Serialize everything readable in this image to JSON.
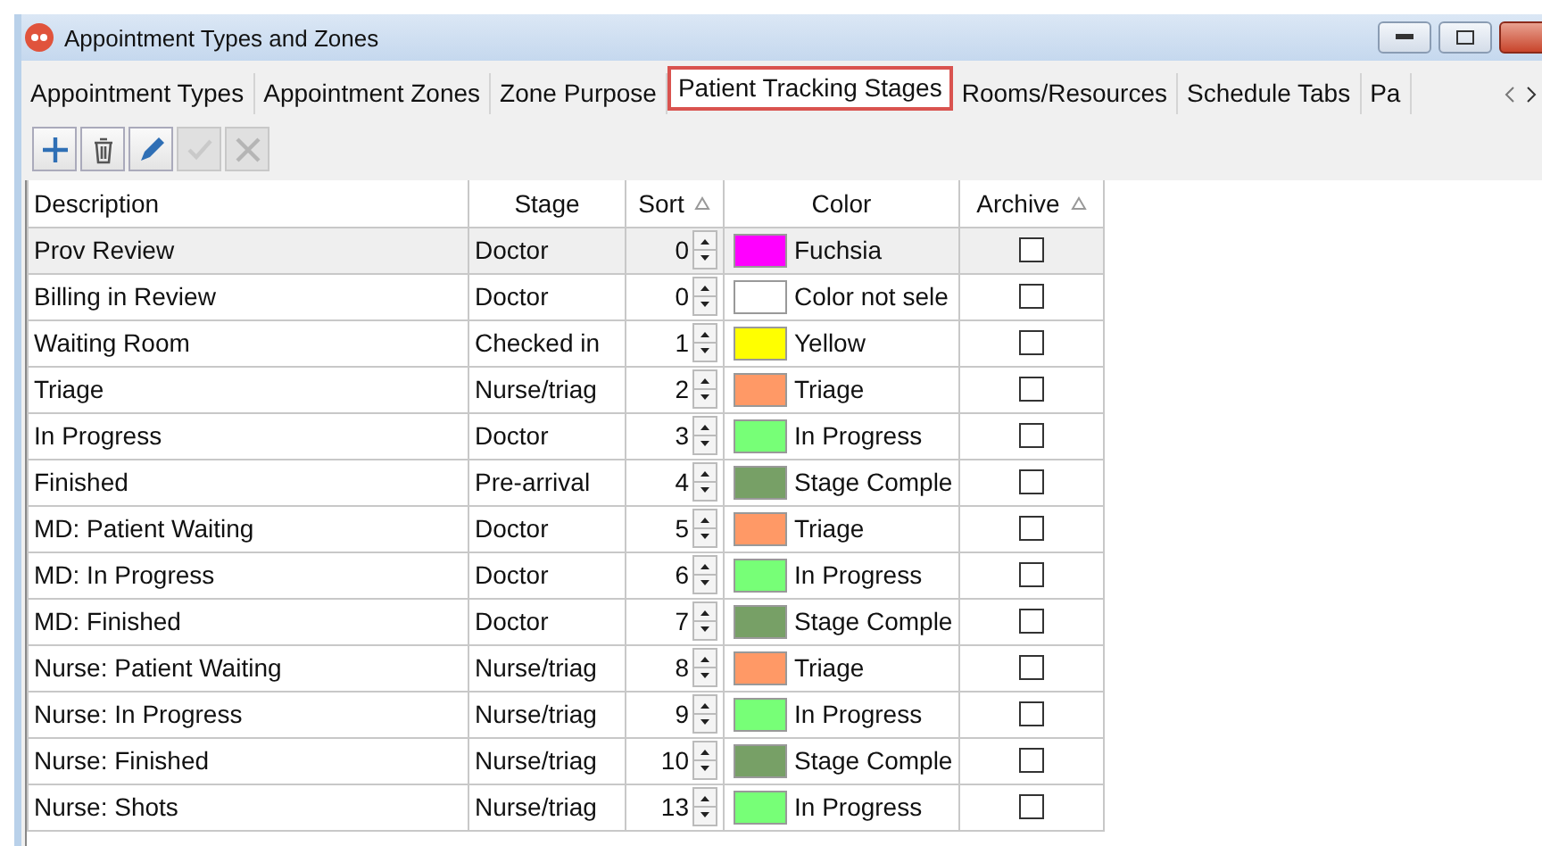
{
  "window": {
    "title": "Appointment Types and Zones"
  },
  "tabs": [
    {
      "label": "Appointment Types",
      "selected": false
    },
    {
      "label": "Appointment Zones",
      "selected": false
    },
    {
      "label": "Zone Purpose",
      "selected": false
    },
    {
      "label": "Patient Tracking Stages",
      "selected": true
    },
    {
      "label": "Rooms/Resources",
      "selected": false
    },
    {
      "label": "Schedule Tabs",
      "selected": false
    },
    {
      "label": "Pa",
      "selected": false
    }
  ],
  "toolbar": [
    {
      "kind": "add",
      "disabled": false
    },
    {
      "kind": "delete",
      "disabled": false
    },
    {
      "kind": "edit",
      "disabled": false
    },
    {
      "kind": "save",
      "disabled": true
    },
    {
      "kind": "cancel",
      "disabled": true
    }
  ],
  "table": {
    "columns": [
      {
        "label": "Description",
        "sorted": false
      },
      {
        "label": "Stage",
        "sorted": false
      },
      {
        "label": "Sort",
        "sorted": true
      },
      {
        "label": "Color",
        "sorted": false
      },
      {
        "label": "Archive",
        "sorted": true
      }
    ],
    "rows": [
      {
        "description": "Prov Review",
        "stage": "Doctor",
        "sort": "0",
        "color": "#ff00ff",
        "color_name": "Fuchsia",
        "archived": false,
        "selected": true
      },
      {
        "description": "Billing in Review",
        "stage": "Doctor",
        "sort": "0",
        "color": "#ffffff",
        "color_name": "Color not sele",
        "archived": false,
        "selected": false
      },
      {
        "description": "Waiting Room",
        "stage": "Checked in",
        "sort": "1",
        "color": "#ffff00",
        "color_name": "Yellow",
        "archived": false,
        "selected": false
      },
      {
        "description": "Triage",
        "stage": "Nurse/triag",
        "sort": "2",
        "color": "#ff9966",
        "color_name": "Triage",
        "archived": false,
        "selected": false
      },
      {
        "description": "In Progress",
        "stage": "Doctor",
        "sort": "3",
        "color": "#77ff77",
        "color_name": "In Progress",
        "archived": false,
        "selected": false
      },
      {
        "description": "Finished",
        "stage": "Pre-arrival",
        "sort": "4",
        "color": "#77a066",
        "color_name": "Stage Comple",
        "archived": false,
        "selected": false
      },
      {
        "description": "MD: Patient Waiting",
        "stage": "Doctor",
        "sort": "5",
        "color": "#ff9966",
        "color_name": "Triage",
        "archived": false,
        "selected": false
      },
      {
        "description": "MD: In Progress",
        "stage": "Doctor",
        "sort": "6",
        "color": "#77ff77",
        "color_name": "In Progress",
        "archived": false,
        "selected": false
      },
      {
        "description": "MD: Finished",
        "stage": "Doctor",
        "sort": "7",
        "color": "#77a066",
        "color_name": "Stage Comple",
        "archived": false,
        "selected": false
      },
      {
        "description": "Nurse: Patient Waiting",
        "stage": "Nurse/triag",
        "sort": "8",
        "color": "#ff9966",
        "color_name": "Triage",
        "archived": false,
        "selected": false
      },
      {
        "description": "Nurse: In Progress",
        "stage": "Nurse/triag",
        "sort": "9",
        "color": "#77ff77",
        "color_name": "In Progress",
        "archived": false,
        "selected": false
      },
      {
        "description": "Nurse: Finished",
        "stage": "Nurse/triag",
        "sort": "10",
        "color": "#77a066",
        "color_name": "Stage Comple",
        "archived": false,
        "selected": false
      },
      {
        "description": "Nurse: Shots",
        "stage": "Nurse/triag",
        "sort": "13",
        "color": "#77ff77",
        "color_name": "In Progress",
        "archived": false,
        "selected": false
      }
    ]
  }
}
